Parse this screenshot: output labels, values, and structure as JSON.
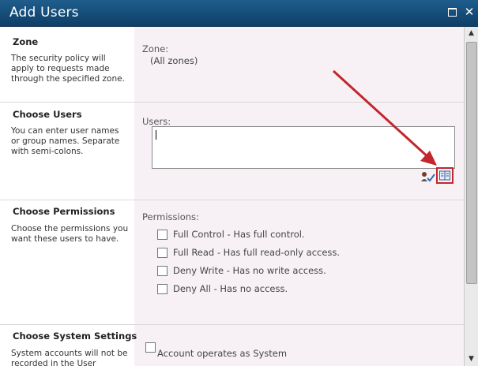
{
  "window": {
    "title": "Add Users"
  },
  "zone": {
    "title": "Zone",
    "description": "The security policy will apply to requests made through the specified zone.",
    "label": "Zone:",
    "value": "(All zones)"
  },
  "choose_users": {
    "title": "Choose Users",
    "description": "You can enter user names or group names. Separate with semi-colons.",
    "label": "Users:",
    "value": ""
  },
  "choose_permissions": {
    "title": "Choose Permissions",
    "description": "Choose the permissions you want these users to have.",
    "label": "Permissions:",
    "options": [
      {
        "label": "Full Control - Has full control.",
        "checked": false
      },
      {
        "label": "Full Read - Has full read-only access.",
        "checked": false
      },
      {
        "label": "Deny Write - Has no write access.",
        "checked": false
      },
      {
        "label": "Deny All - Has no access.",
        "checked": false
      }
    ]
  },
  "system_settings": {
    "title": "Choose System Settings",
    "description": "System accounts will not be recorded in the User",
    "option": {
      "label": "Account operates as System",
      "checked": false
    }
  },
  "icons": {
    "maximize": "maximize-icon",
    "close": "close-icon",
    "check_names": "check-names-icon",
    "browse": "address-book-icon",
    "annotation": "red-arrow-icon"
  },
  "colors": {
    "titlebar": "#1a5280",
    "annotation": "#c1272d",
    "right_panel": "#f7f1f5"
  }
}
